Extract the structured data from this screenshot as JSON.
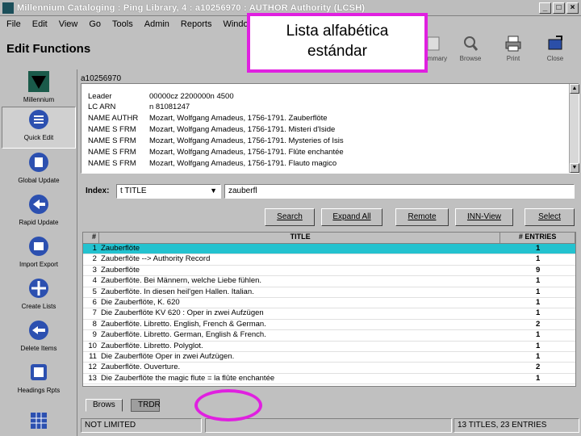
{
  "window": {
    "title": "Millennium Cataloging : Ping Library, 4 : a10256970 : AUTHOR Authority (LCSH)"
  },
  "menu": [
    "File",
    "Edit",
    "View",
    "Go",
    "Tools",
    "Admin",
    "Reports",
    "Window"
  ],
  "toolbar": {
    "title": "Edit Functions",
    "buttons": [
      {
        "label": "Summary",
        "icon": "summary-icon"
      },
      {
        "label": "Browse",
        "icon": "magnifier-icon"
      },
      {
        "label": "Print",
        "icon": "printer-icon"
      },
      {
        "label": "Close",
        "icon": "close-folder-icon"
      }
    ]
  },
  "callout": {
    "line1": "Lista alfabética",
    "line2": "estándar"
  },
  "sidebar": [
    {
      "label": "Millennium",
      "icon": "millennium-logo-icon"
    },
    {
      "label": "Quick Edit",
      "icon": "quick-edit-icon"
    },
    {
      "label": "Global Update",
      "icon": "global-update-icon"
    },
    {
      "label": "Rapid Update",
      "icon": "rapid-update-icon"
    },
    {
      "label": "Import Export",
      "icon": "import-export-icon"
    },
    {
      "label": "Create Lists",
      "icon": "create-lists-icon"
    },
    {
      "label": "Delete Items",
      "icon": "delete-items-icon"
    },
    {
      "label": "Headings Rpts",
      "icon": "headings-reports-icon"
    }
  ],
  "record": {
    "id": "a10256970",
    "fields": [
      {
        "tag": "Leader",
        "value": "00000cz  2200000n  4500"
      },
      {
        "tag": "LC ARN",
        "value": "n  81081247"
      },
      {
        "tag": "NAME AUTHR",
        "value": "Mozart, Wolfgang Amadeus, 1756-1791. Zauberflöte"
      },
      {
        "tag": "NAME S FRM",
        "value": "Mozart, Wolfgang Amadeus, 1756-1791. Misteri d'Iside"
      },
      {
        "tag": "NAME S FRM",
        "value": "Mozart, Wolfgang Amadeus, 1756-1791. Mysteries of Isis"
      },
      {
        "tag": "NAME S FRM",
        "value": "Mozart, Wolfgang Amadeus, 1756-1791. Flûte enchantée"
      },
      {
        "tag": "NAME S FRM",
        "value": "Mozart, Wolfgang Amadeus, 1756-1791. Flauto magico"
      }
    ]
  },
  "index": {
    "label": "Index:",
    "selected": "t TITLE",
    "query": "zauberfl"
  },
  "buttons": {
    "search": "Search",
    "expand": "Expand All",
    "remote": "Remote",
    "innview": "INN-View",
    "select": "Select"
  },
  "results": {
    "headers": {
      "num": "#",
      "title": "TITLE",
      "entries": "# ENTRIES"
    },
    "rows": [
      {
        "n": "1",
        "title": "Zauberflöte",
        "entries": "1"
      },
      {
        "n": "2",
        "title": "Zauberflöte --> Authority Record",
        "entries": "1"
      },
      {
        "n": "3",
        "title": "Zauberflöte",
        "entries": "9"
      },
      {
        "n": "4",
        "title": "Zauberflöte. Bei Männern, welche Liebe fühlen.",
        "entries": "1"
      },
      {
        "n": "5",
        "title": "Zauberflöte. In diesen heil'gen Hallen. Italian.",
        "entries": "1"
      },
      {
        "n": "6",
        "title": "Die Zauberflöte, K. 620",
        "entries": "1"
      },
      {
        "n": "7",
        "title": "Die Zauberflöte KV 620 : Oper in zwei Aufzügen",
        "entries": "1"
      },
      {
        "n": "8",
        "title": "Zauberflöte. Libretto. English, French & German.",
        "entries": "2"
      },
      {
        "n": "9",
        "title": "Zauberflöte. Libretto. German, English & French.",
        "entries": "1"
      },
      {
        "n": "10",
        "title": "Zauberflöte. Libretto. Polyglot.",
        "entries": "1"
      },
      {
        "n": "11",
        "title": "Die Zauberflöte Oper in zwei Aufzügen.",
        "entries": "1"
      },
      {
        "n": "12",
        "title": "Zauberflöte. Ouverture.",
        "entries": "2"
      },
      {
        "n": "13",
        "title": "Die Zauberflöte the magic flute = la flûte enchantée",
        "entries": "1"
      }
    ]
  },
  "tabs": [
    "Brows",
    "TRDR"
  ],
  "status": {
    "left": "NOT LIMITED",
    "right": "13 TITLES, 23 ENTRIES"
  },
  "colors": {
    "selection": "#23c2cf",
    "highlight": "#e020e0"
  }
}
